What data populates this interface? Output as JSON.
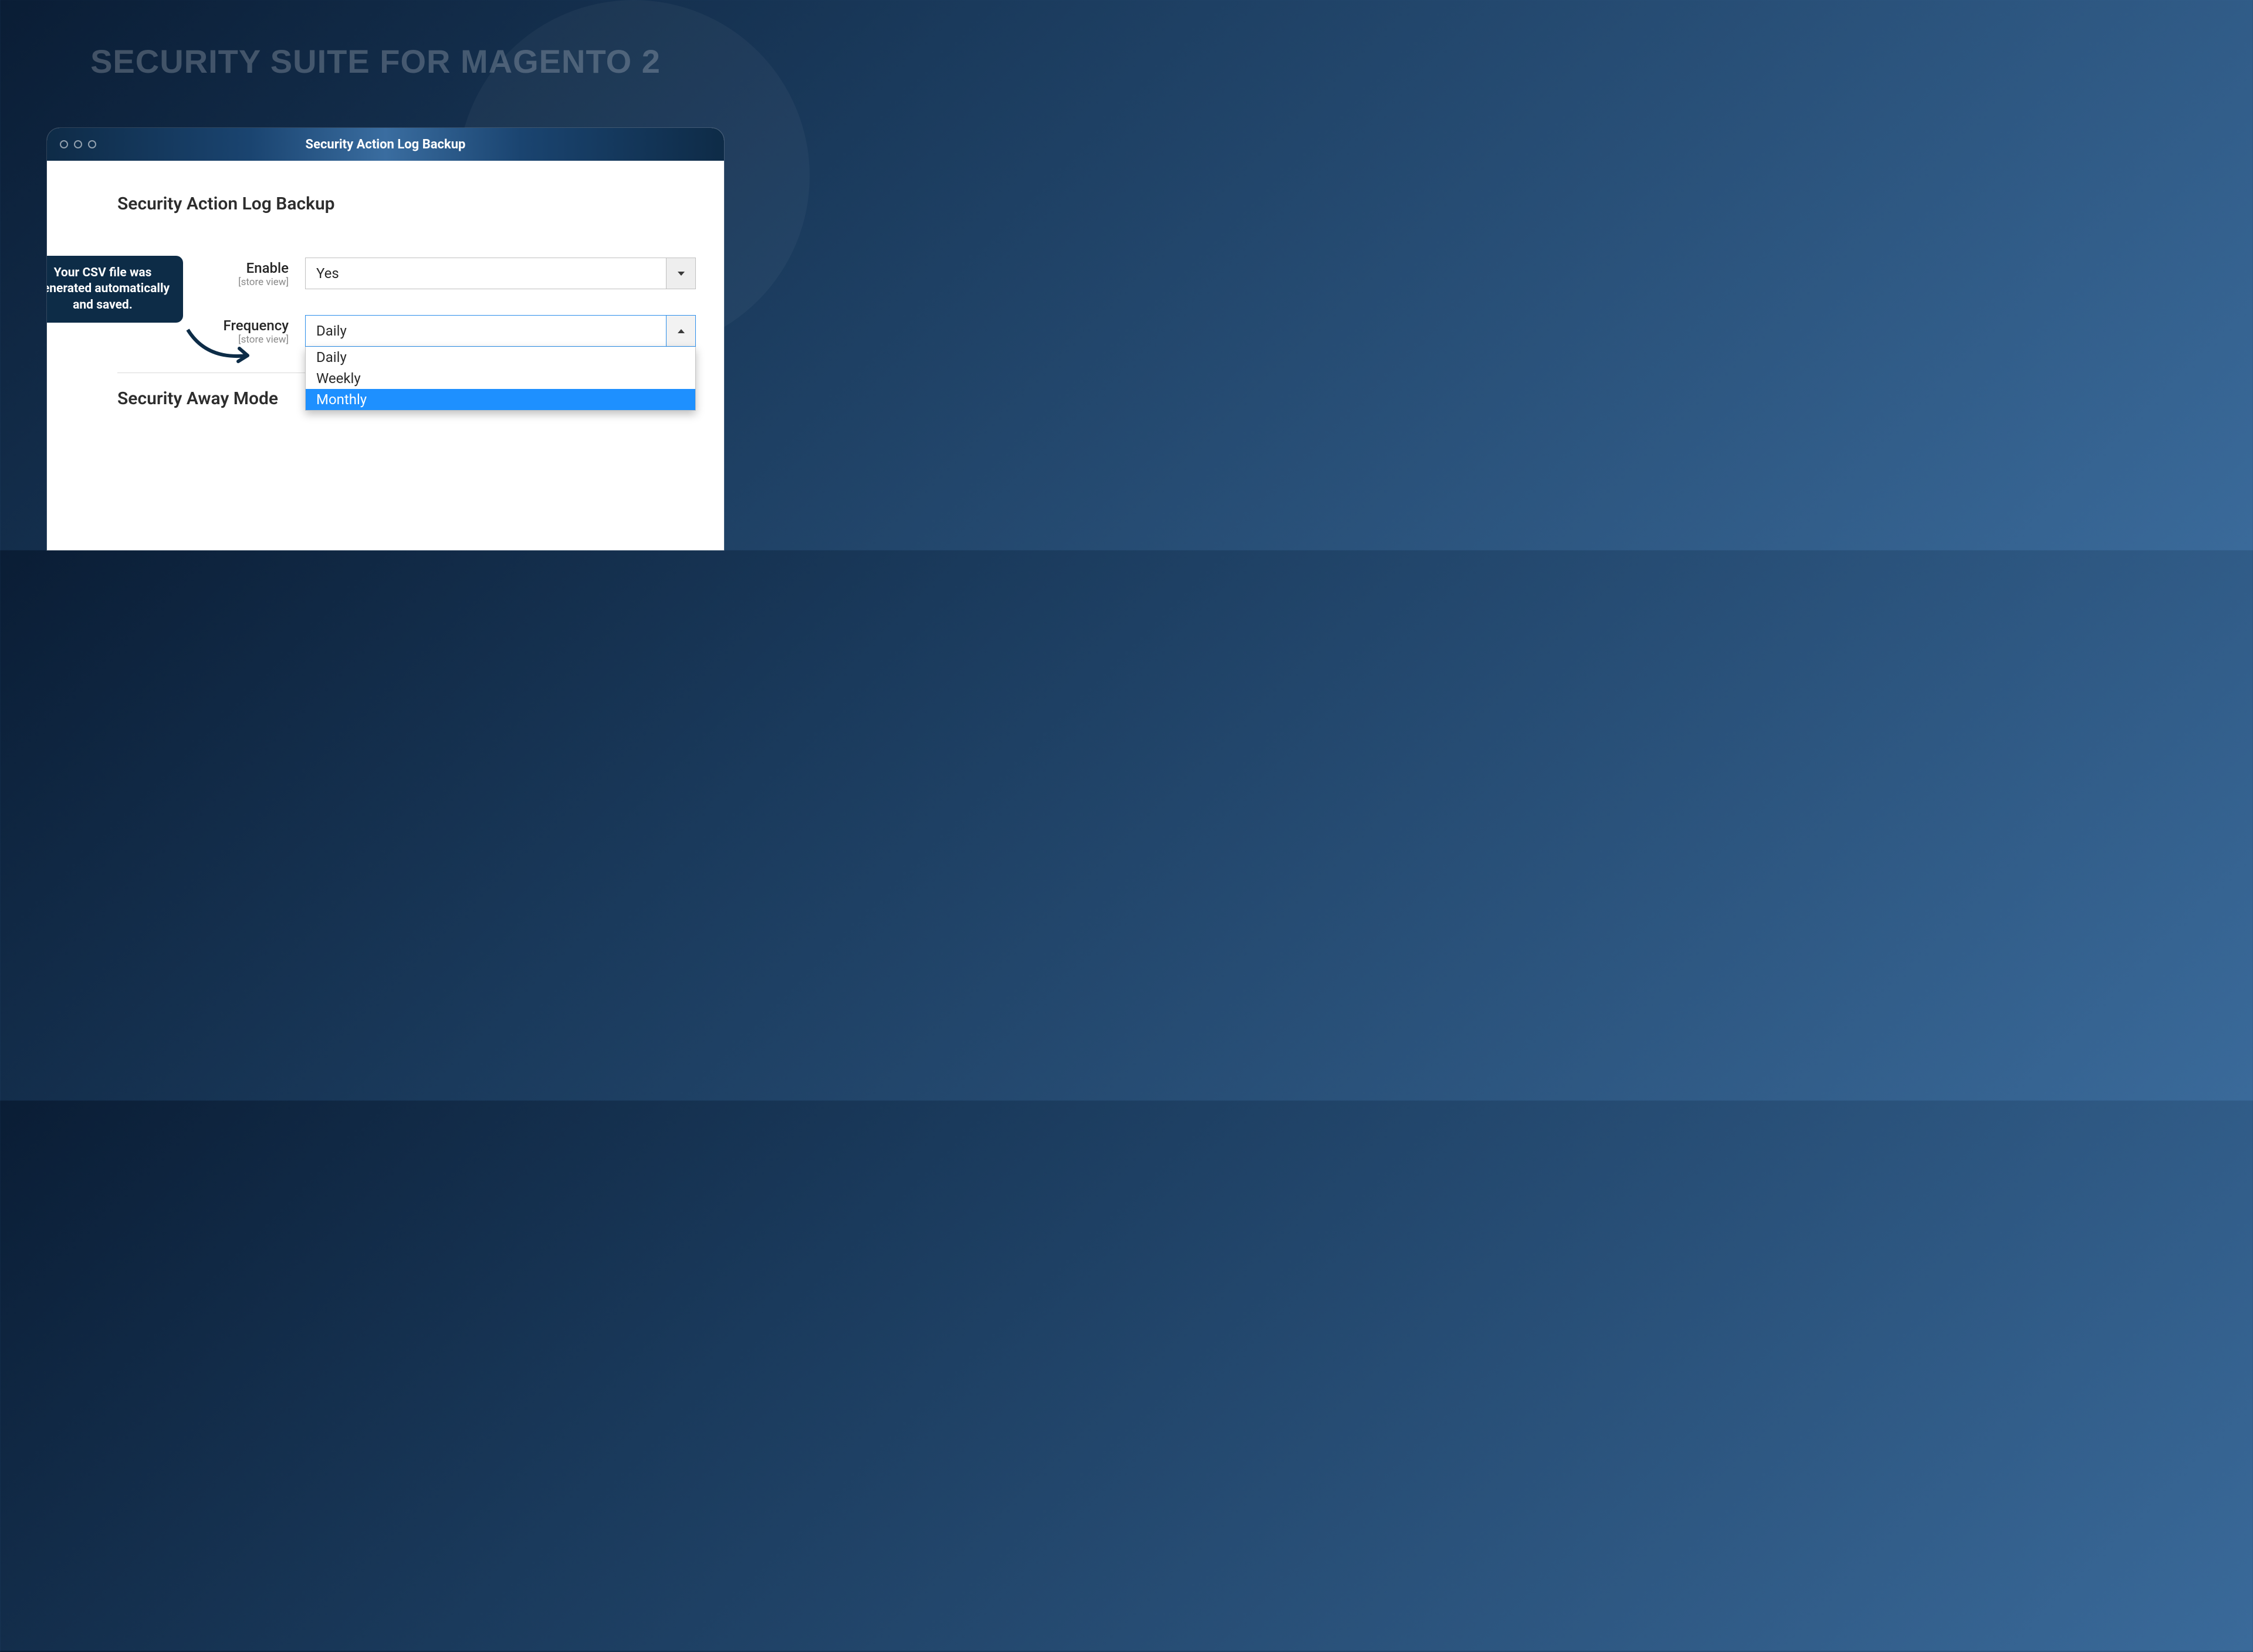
{
  "hero": {
    "title": "SECURITY SUITE FOR MAGENTO 2"
  },
  "window": {
    "title": "Security Action Log Backup"
  },
  "callout": {
    "text": "Your CSV file was generated automatically and saved."
  },
  "sections": {
    "backup": {
      "title": "Security Action Log Backup",
      "enable": {
        "label": "Enable",
        "scope": "[store view]",
        "value": "Yes"
      },
      "frequency": {
        "label": "Frequency",
        "scope": "[store view]",
        "value": "Daily",
        "options": [
          "Daily",
          "Weekly",
          "Monthly"
        ],
        "highlighted_index": 2
      }
    },
    "away": {
      "title": "Security Away Mode"
    }
  }
}
